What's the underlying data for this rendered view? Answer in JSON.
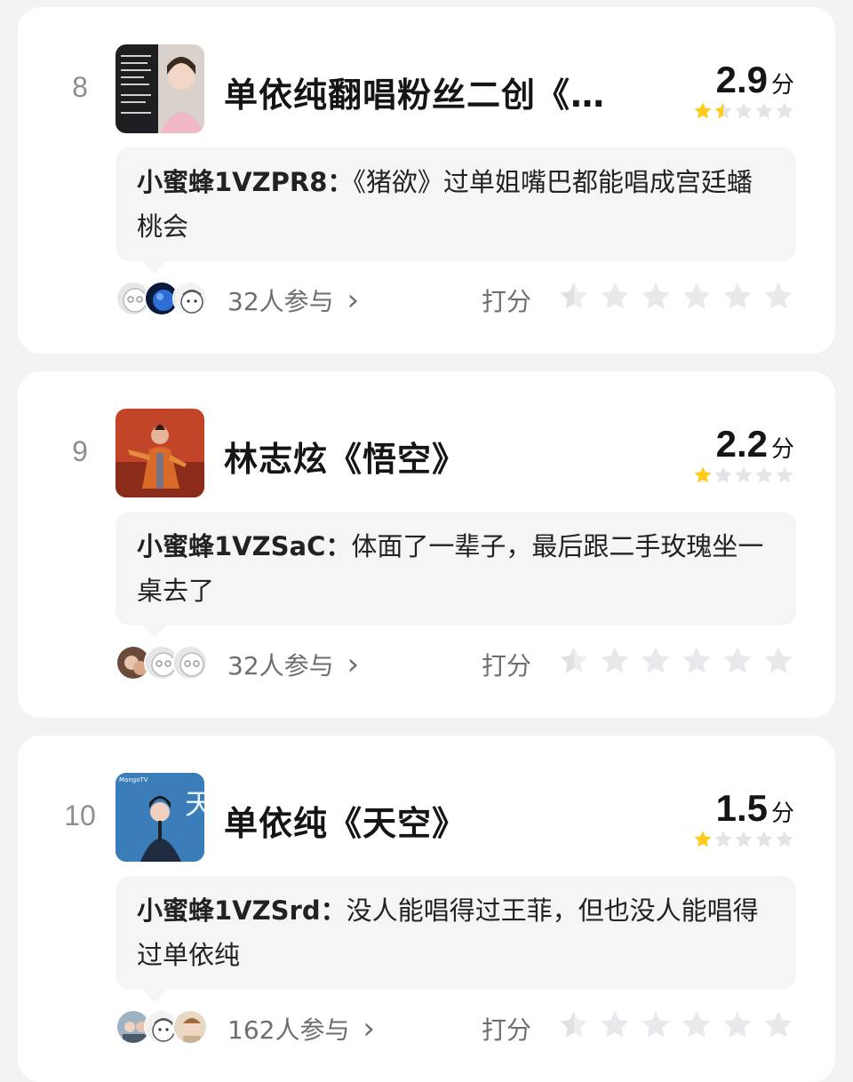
{
  "items": [
    {
      "rank": "8",
      "title": "单依纯翻唱粉丝二创《…",
      "score": "2.9",
      "score_unit": "分",
      "score_stars": 1.5,
      "comment_user": "小蜜蜂1VZPR8：",
      "comment_text": "《猪欲》过单姐嘴巴都能唱成宫廷蟠桃会",
      "participants": "32人参与",
      "chevron": "›",
      "rate_label": "打分",
      "thumbnail_icon": "poster-woman-thumbnail",
      "avatar_icons": [
        "emoji-avatar",
        "planet-avatar",
        "cartoon-avatar"
      ]
    },
    {
      "rank": "9",
      "title": "林志炫《悟空》",
      "score": "2.2",
      "score_unit": "分",
      "score_stars": 1,
      "comment_user": "小蜜蜂1VZSaC：",
      "comment_text": "体面了一辈子，最后跟二手玫瑰坐一桌去了",
      "participants": "32人参与",
      "chevron": "›",
      "rate_label": "打分",
      "thumbnail_icon": "singer-stage-thumbnail",
      "avatar_icons": [
        "photo-avatar",
        "emoji-avatar",
        "emoji-avatar"
      ]
    },
    {
      "rank": "10",
      "title": "单依纯《天空》",
      "score": "1.5",
      "score_unit": "分",
      "score_stars": 1,
      "comment_user": "小蜜蜂1VZSrd：",
      "comment_text": "没人能唱得过王菲，但也没人能唱得过单依纯",
      "participants": "162人参与",
      "chevron": "›",
      "rate_label": "打分",
      "thumbnail_icon": "singer-blue-thumbnail",
      "avatar_icons": [
        "couple-avatar",
        "cartoon-avatar",
        "person-avatar"
      ]
    }
  ],
  "colors": {
    "star_filled": "#ffcc1e",
    "star_empty": "#e4e4e8",
    "rank_text": "#8e8e8e",
    "comment_bg": "#f5f5f7"
  }
}
